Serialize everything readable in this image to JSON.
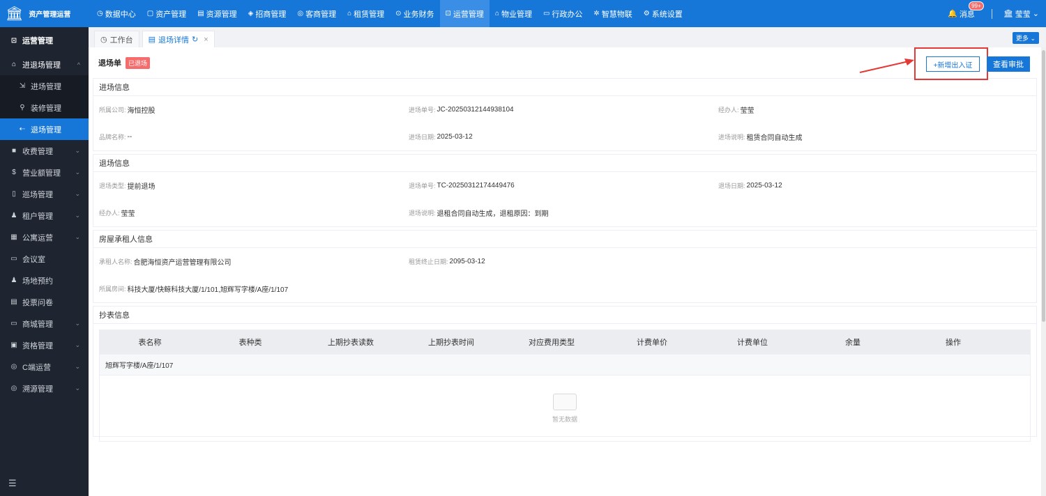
{
  "app": {
    "title": "资产管理运营"
  },
  "topnav": [
    {
      "icon": "◷",
      "label": "数据中心"
    },
    {
      "icon": "▢",
      "label": "资产管理"
    },
    {
      "icon": "▤",
      "label": "资源管理"
    },
    {
      "icon": "◈",
      "label": "招商管理"
    },
    {
      "icon": "◎",
      "label": "客商管理"
    },
    {
      "icon": "⌂",
      "label": "租赁管理"
    },
    {
      "icon": "⊙",
      "label": "业务财务"
    },
    {
      "icon": "⊡",
      "label": "运营管理"
    },
    {
      "icon": "⌂",
      "label": "物业管理"
    },
    {
      "icon": "▭",
      "label": "行政办公"
    },
    {
      "icon": "✲",
      "label": "智慧物联"
    },
    {
      "icon": "⚙",
      "label": "系统设置"
    }
  ],
  "topright": {
    "messages_label": "消息",
    "messages_count": "99+",
    "user": "莹莹"
  },
  "sidebar": {
    "header": "运营管理",
    "items": [
      {
        "icon": "⌂",
        "label": "进退场管理"
      },
      {
        "icon": "⇲",
        "label": "进场管理"
      },
      {
        "icon": "⚲",
        "label": "装修管理"
      },
      {
        "icon": "⇠",
        "label": "退场管理"
      },
      {
        "icon": "■",
        "label": "收费管理"
      },
      {
        "icon": "$",
        "label": "营业额管理"
      },
      {
        "icon": "▯",
        "label": "巡场管理"
      },
      {
        "icon": "♟",
        "label": "租户管理"
      },
      {
        "icon": "▦",
        "label": "公寓运营"
      },
      {
        "icon": "▭",
        "label": "会议室"
      },
      {
        "icon": "♟",
        "label": "场地预约"
      },
      {
        "icon": "▤",
        "label": "投票问卷"
      },
      {
        "icon": "▭",
        "label": "商城管理"
      },
      {
        "icon": "▣",
        "label": "资格管理"
      },
      {
        "icon": "◎",
        "label": "C端运营"
      },
      {
        "icon": "◎",
        "label": "溯源管理"
      }
    ]
  },
  "tabs": [
    {
      "label": "工作台"
    },
    {
      "label": "退场详情"
    }
  ],
  "more_label": "更多",
  "page": {
    "title": "退场单",
    "status": "已退场",
    "add_button": "+新增出入证",
    "view_button": "查看审批"
  },
  "entry": {
    "title": "进场信息",
    "fields": [
      {
        "label": "所属公司:",
        "value": "海恒控股"
      },
      {
        "label": "进场单号:",
        "value": "JC-20250312144938104"
      },
      {
        "label": "经办人:",
        "value": "莹莹"
      },
      {
        "label": "品牌名称:",
        "value": "--"
      },
      {
        "label": "进场日期:",
        "value": "2025-03-12"
      },
      {
        "label": "进场说明:",
        "value": "租赁合同自动生成"
      }
    ]
  },
  "exit": {
    "title": "退场信息",
    "fields": [
      {
        "label": "退场类型:",
        "value": "提前退场"
      },
      {
        "label": "退场单号:",
        "value": "TC-20250312174449476"
      },
      {
        "label": "退场日期:",
        "value": "2025-03-12"
      },
      {
        "label": "经办人:",
        "value": "莹莹"
      },
      {
        "label": "退场说明:",
        "value": "退租合同自动生成，退租原因：到期"
      }
    ]
  },
  "tenant": {
    "title": "房屋承租人信息",
    "fields": [
      {
        "label": "承租人名称:",
        "value": "合肥海恒资产运营管理有限公司"
      },
      {
        "label": "租赁终止日期:",
        "value": "2095-03-12"
      },
      {
        "label": "所属房间:",
        "value": "科技大厦/快鲸科技大厦/1/101,旭辉写字楼/A座/1/107"
      }
    ]
  },
  "meter": {
    "title": "抄表信息",
    "columns": [
      "表名称",
      "表种类",
      "上期抄表读数",
      "上期抄表时间",
      "对应费用类型",
      "计费单价",
      "计费单位",
      "余量",
      "操作"
    ],
    "group": "旭辉写字楼/A座/1/107",
    "empty_text": "暂无数据"
  }
}
